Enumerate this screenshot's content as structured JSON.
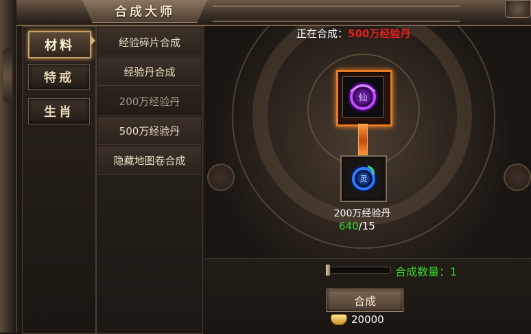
{
  "window": {
    "title": "合成大师"
  },
  "categories": [
    {
      "label": "材料",
      "active": true
    },
    {
      "label": "特戒",
      "active": false
    },
    {
      "label": "生肖",
      "active": false
    }
  ],
  "recipes": [
    {
      "label": "经验碎片合成",
      "dim": false
    },
    {
      "label": "经验丹合成",
      "dim": false
    },
    {
      "label": "200万经验丹",
      "dim": true
    },
    {
      "label": "500万经验丹",
      "dim": false
    },
    {
      "label": "隐藏地图卷合成",
      "dim": false
    }
  ],
  "status": {
    "prefix": "正在合成：",
    "target": "500万经验丹"
  },
  "target_item": {
    "icon": "purple-orb-icon",
    "glyph": "仙"
  },
  "source_item": {
    "icon": "blue-orb-icon",
    "glyph": "灵",
    "name": "200万经验丹",
    "have": "640",
    "need": "/15"
  },
  "quantity": {
    "label": "合成数量：",
    "value": "1",
    "slider_fraction": 0
  },
  "craft_button": {
    "label": "合成"
  },
  "cost": {
    "icon": "gold-ingot-icon",
    "value": "20000"
  },
  "colors": {
    "accent_orange": "#e87a1f",
    "status_red": "#e2201e",
    "quantity_green": "#35d22a"
  }
}
